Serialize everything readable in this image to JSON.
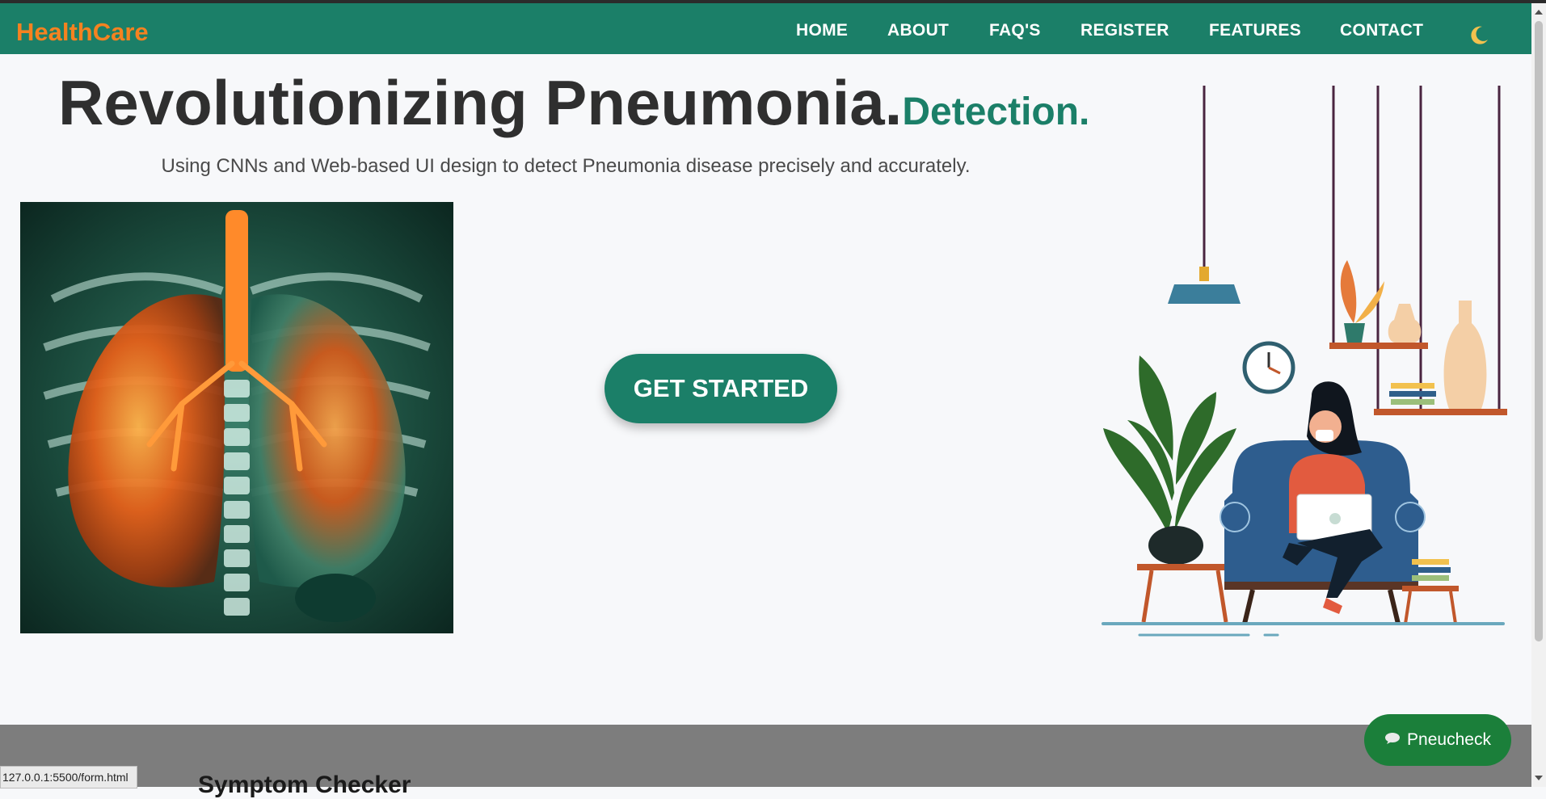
{
  "brand": "HealthCare",
  "nav": {
    "items": [
      "HOME",
      "ABOUT",
      "FAQ'S",
      "REGISTER",
      "FEATURES",
      "CONTACT"
    ],
    "theme_toggle_icon": "moon-icon"
  },
  "hero": {
    "title_main": "Revolutionizing Pneumonia.",
    "title_accent": "Detection.",
    "subtitle": "Using CNNs and Web-based UI design to detect Pneumonia disease precisely and accurately.",
    "cta_label": "GET STARTED"
  },
  "images": {
    "xray": "lungs-xray-image",
    "illustration": "woman-with-laptop-illustration"
  },
  "next_section": {
    "heading": "Symptom Checker"
  },
  "chat": {
    "icon": "chat-bubble-icon",
    "label": "Pneucheck"
  },
  "status_bar": {
    "url": "127.0.0.1:5500/form.html"
  },
  "colors": {
    "brand_green": "#1b7f68",
    "brand_orange": "#f58220",
    "chat_green": "#1b7f3a"
  }
}
